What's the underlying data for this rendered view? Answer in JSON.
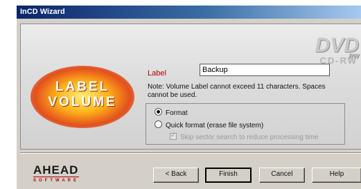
{
  "window": {
    "title": "InCD Wizard"
  },
  "logo": {
    "line1": "LABEL",
    "line2": "VOLUME"
  },
  "brand_mark": {
    "dvd": "DVD",
    "dvd_small": "RW",
    "cdrw": "CD-RW"
  },
  "form": {
    "label_caption": "Label",
    "label_value": "Backup",
    "note": "Note: Volume Label cannot exceed 11 characters. Spaces cannot be used."
  },
  "options": {
    "format": {
      "label": "Format",
      "selected": true
    },
    "quick_format": {
      "label": "Quick format (erase file system)",
      "selected": false
    },
    "skip_sector": {
      "label": "Skip sector search to reduce processing time",
      "checked": true,
      "enabled": false
    }
  },
  "footer": {
    "company": "AHEAD",
    "company_sub": "SOFTWARE",
    "back_label": "< Back",
    "finish_label": "Finish",
    "cancel_label": "Cancel",
    "help_label": "Help"
  }
}
